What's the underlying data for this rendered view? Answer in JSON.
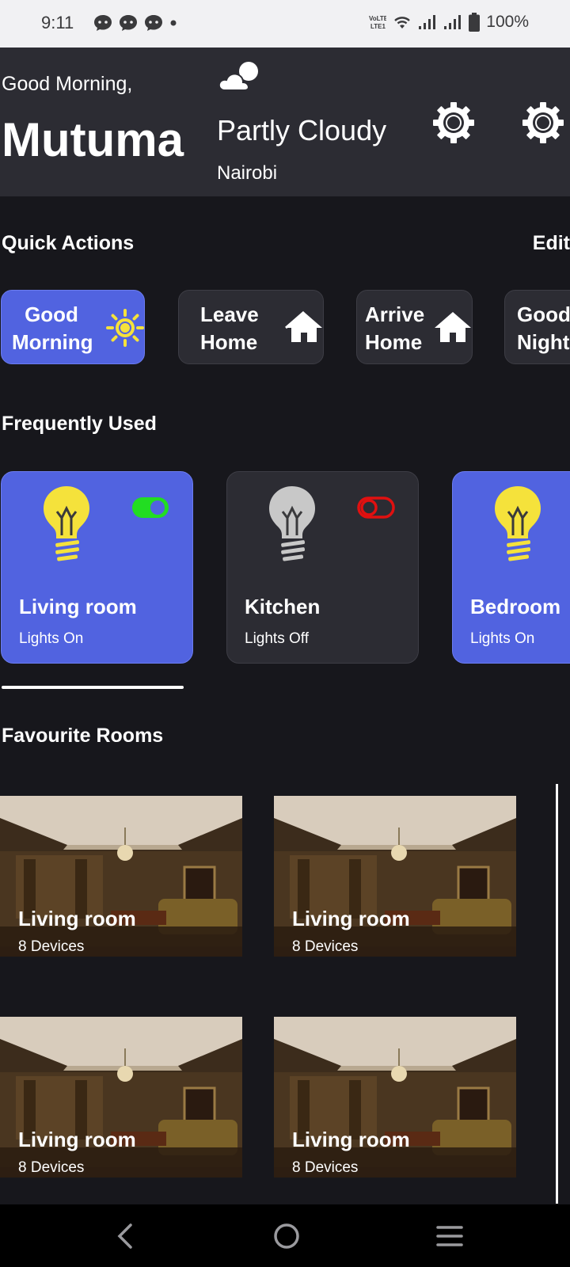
{
  "status_bar": {
    "time": "9:11",
    "battery": "100%",
    "icons": [
      "messenger-icon",
      "messenger-icon",
      "messenger-icon",
      "dot-icon",
      "volte-icon",
      "wifi-icon",
      "signal-icon",
      "signal-icon",
      "battery-icon"
    ]
  },
  "header": {
    "greeting": "Good Morning,",
    "user_name": "Mutuma",
    "weather": {
      "icon": "partly-cloudy-icon",
      "description": "Partly Cloudy",
      "city": "Nairobi"
    },
    "actions": [
      "gear-icon",
      "gear-icon"
    ]
  },
  "quick_actions": {
    "title": "Quick Actions",
    "edit_label": "Edit",
    "items": [
      {
        "line1": "Good",
        "line2": "Morning",
        "icon": "sun-icon",
        "active": true
      },
      {
        "line1": "Leave",
        "line2": "Home",
        "icon": "home-icon",
        "active": false
      },
      {
        "line1": "Arrive",
        "line2": "Home",
        "icon": "home-icon",
        "active": false
      },
      {
        "line1": "Good",
        "line2": "Night",
        "icon": "moon-icon",
        "active": false
      }
    ]
  },
  "frequently_used": {
    "title": "Frequently Used",
    "items": [
      {
        "name": "Living room",
        "status": "Lights On",
        "on": true,
        "accent": "#5163e0",
        "toggle_color": "#22dd22"
      },
      {
        "name": "Kitchen",
        "status": "Lights Off",
        "on": false,
        "accent": "#2c2c33",
        "toggle_color": "#e01010"
      },
      {
        "name": "Bedroom",
        "status": "Lights On",
        "on": true,
        "accent": "#5163e0",
        "toggle_color": "#22dd22"
      }
    ]
  },
  "favourite_rooms": {
    "title": "Favourite Rooms",
    "items": [
      {
        "name": "Living room",
        "devices": "8 Devices"
      },
      {
        "name": "Living room",
        "devices": "8 Devices"
      },
      {
        "name": "Living room",
        "devices": "8 Devices"
      },
      {
        "name": "Living room",
        "devices": "8 Devices"
      }
    ]
  },
  "nav_bar": {
    "buttons": [
      "back-icon",
      "home-circle-icon",
      "recents-icon"
    ]
  },
  "colors": {
    "background": "#17171c",
    "card": "#2c2c33",
    "accent": "#5163e0",
    "toggle_on": "#22dd22",
    "toggle_off": "#e01010",
    "bulb_on": "#f5e23b",
    "bulb_off": "#c8c8c8"
  }
}
